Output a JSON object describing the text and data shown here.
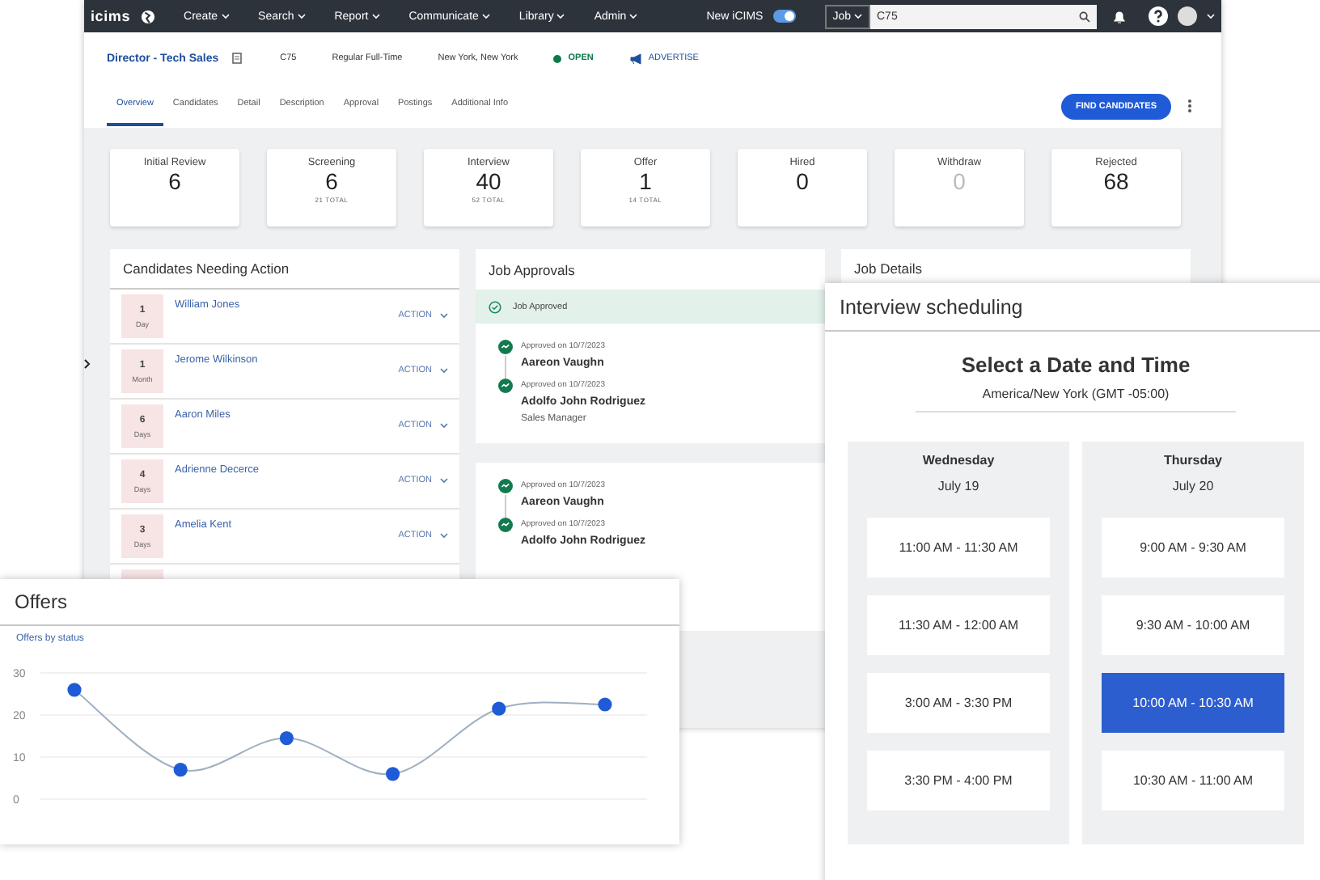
{
  "topbar": {
    "logo": "icims",
    "menu": [
      "Create",
      "Search",
      "Report",
      "Communicate",
      "Library",
      "Admin"
    ],
    "toggle": {
      "label": "New iCIMS",
      "on": true
    },
    "search": {
      "scope": "Job",
      "value": "C75"
    }
  },
  "job": {
    "title": "Director - Tech Sales",
    "code": "C75",
    "type": "Regular Full-Time",
    "location": "New York, New York",
    "status": "OPEN",
    "advertise": "ADVERTISE"
  },
  "tabs": [
    {
      "label": "Overview",
      "selected": true
    },
    {
      "label": "Candidates",
      "selected": false
    },
    {
      "label": "Detail",
      "selected": false
    },
    {
      "label": "Description",
      "selected": false
    },
    {
      "label": "Approval",
      "selected": false
    },
    {
      "label": "Postings",
      "selected": false
    },
    {
      "label": "Additional Info",
      "selected": false
    }
  ],
  "find_button": "FIND CANDIDATES",
  "stats": [
    {
      "label": "Initial Review",
      "count": "6",
      "muted": false
    },
    {
      "label": "Screening",
      "count": "6",
      "total": "21 TOTAL",
      "muted": false
    },
    {
      "label": "Interview",
      "count": "40",
      "total": "52 TOTAL",
      "muted": false
    },
    {
      "label": "Offer",
      "count": "1",
      "total": "14 TOTAL",
      "muted": false
    },
    {
      "label": "Hired",
      "count": "0",
      "muted": false
    },
    {
      "label": "Withdraw",
      "count": "0",
      "muted": true
    },
    {
      "label": "Rejected",
      "count": "68",
      "muted": false
    }
  ],
  "candidates": {
    "title": "Candidates Needing Action",
    "rows": [
      {
        "count": "1",
        "unit": "Day",
        "name": "William Jones",
        "action": "ACTION"
      },
      {
        "count": "1",
        "unit": "Month",
        "name": "Jerome Wilkinson",
        "action": "ACTION"
      },
      {
        "count": "6",
        "unit": "Days",
        "name": "Aaron Miles",
        "action": "ACTION"
      },
      {
        "count": "4",
        "unit": "Days",
        "name": "Adrienne Decerce",
        "action": "ACTION"
      },
      {
        "count": "3",
        "unit": "Days",
        "name": "Amelia Kent",
        "action": "ACTION"
      }
    ]
  },
  "approvals": {
    "title": "Job Approvals",
    "banner": "Job Approved",
    "groups": [
      [
        {
          "date": "Approved on 10/7/2023",
          "name": "Aareon Vaughn"
        },
        {
          "date": "Approved on 10/7/2023",
          "name": "Adolfo John Rodriguez",
          "role": "Sales Manager"
        }
      ],
      [
        {
          "date": "Approved on 10/7/2023",
          "name": "Aareon Vaughn"
        },
        {
          "date": "Approved on 10/7/2023",
          "name": "Adolfo John Rodriguez"
        }
      ]
    ]
  },
  "job_details": {
    "title": "Job Details"
  },
  "offers": {
    "title": "Offers",
    "subtitle": "Offers by status",
    "chart_data": {
      "type": "line",
      "series": [
        {
          "color": "#1f5bd6",
          "marker": "circle",
          "values": [
            26,
            7,
            14.5,
            6,
            21.5,
            22.5
          ]
        }
      ],
      "ylim": [
        0,
        30
      ],
      "yticks": [
        0,
        10,
        20,
        30
      ]
    }
  },
  "scheduling": {
    "title": "Interview scheduling",
    "heading": "Select a Date and Time",
    "timezone": "America/New York (GMT -05:00)",
    "days": [
      {
        "weekday": "Wednesday",
        "date": "July 19",
        "slots": [
          {
            "label": "11:00 AM - 11:30 AM",
            "selected": false
          },
          {
            "label": "11:30 AM - 12:00 AM",
            "selected": false
          },
          {
            "label": "3:00 AM - 3:30 PM",
            "selected": false
          },
          {
            "label": "3:30 PM - 4:00 PM",
            "selected": false
          }
        ]
      },
      {
        "weekday": "Thursday",
        "date": "July 20",
        "slots": [
          {
            "label": "9:00 AM - 9:30 AM",
            "selected": false
          },
          {
            "label": "9:30 AM - 10:00 AM",
            "selected": false
          },
          {
            "label": "10:00 AM - 10:30 AM",
            "selected": true
          },
          {
            "label": "10:30 AM - 11:00 AM",
            "selected": false
          }
        ]
      }
    ]
  }
}
